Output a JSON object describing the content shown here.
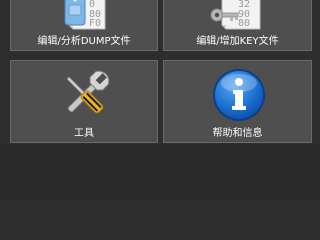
{
  "menu": {
    "tiles": [
      {
        "label": "编辑/分析DUMP文件",
        "icon": "dump-file-icon"
      },
      {
        "label": "编辑/增加KEY文件",
        "icon": "key-file-icon"
      },
      {
        "label": "工具",
        "icon": "tools-icon"
      },
      {
        "label": "帮助和信息",
        "icon": "info-icon"
      }
    ],
    "dump_file_digits": [
      "0",
      "80",
      "F0"
    ],
    "key_file_digits": [
      "32",
      "90",
      "80"
    ]
  },
  "colors": {
    "background": "#2e2e2e",
    "tile": "#4f4f4f",
    "tile_border": "#6a6a6a",
    "info_blue": "#1a6fd1"
  }
}
